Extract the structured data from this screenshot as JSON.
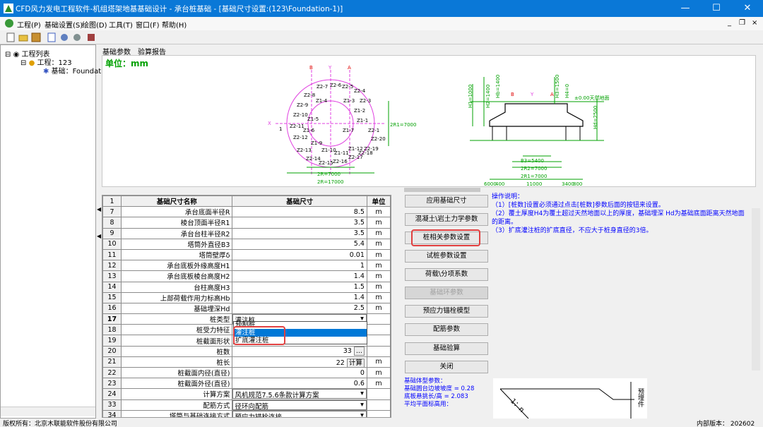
{
  "window": {
    "title": "CFD风力发电工程软件-机组塔架地基基础设计  -  承台桩基础  -  [基础尺寸设置:(123\\Foundation-1)]",
    "min": "—",
    "max": "☐",
    "close": "✕"
  },
  "menu": [
    "工程(P)",
    "基础设置(S)",
    "绘图(D)",
    "工具(T)",
    "窗口(F)",
    "帮助(H)"
  ],
  "mdi": {
    "min": "_",
    "restore": "❐",
    "close": "×"
  },
  "tree": {
    "root": "工程列表",
    "project": "工程：123",
    "foundation": "基础：Foundat"
  },
  "tabs": [
    "基础参数",
    "验算报告"
  ],
  "drawing": {
    "unit": "单位：mm",
    "plan": {
      "labels": [
        "B",
        "Y",
        "A",
        "X",
        "1",
        "2R=7000",
        "2R=17000",
        "2R1=7000"
      ],
      "piles": [
        "Z2-7",
        "Z2-6",
        "Z2-5",
        "Z2-4",
        "Z2-8",
        "Z1-3",
        "Z2-3",
        "Z2-9",
        "Z1-4",
        "Z1-2",
        "Z2-10",
        "Z1-5",
        "Z1-1",
        "Z2-11",
        "Z1-6",
        "Z2-12",
        "Z1-9",
        "Z1-7",
        "Z2-1",
        "Z2-13",
        "Z1-10",
        "Z1-11",
        "Z1-12",
        "Z2-19",
        "Z2-14",
        "Z2-16",
        "Z2-17",
        "Z2-18",
        "Z2-15",
        "Z2-20"
      ]
    },
    "section": {
      "labels": [
        "H1=1000",
        "H2=1400",
        "Hb=1400",
        "H3=1500",
        "H4=0",
        "±0.00天然地面",
        "Hd=2500",
        "B",
        "Y",
        "A",
        "B3=5400",
        "2R2=7000",
        "2R1=7000",
        "11000",
        "6000",
        "400",
        "3400",
        "800"
      ]
    }
  },
  "table": {
    "headers": {
      "no": "1",
      "name": "基础尺寸名称",
      "value": "基础尺寸",
      "unit": "单位"
    },
    "rows": [
      {
        "no": "7",
        "name": "承台底面半径R",
        "value": "8.5",
        "unit": "m"
      },
      {
        "no": "8",
        "name": "棱台顶面半径R1",
        "value": "3.5",
        "unit": "m"
      },
      {
        "no": "9",
        "name": "承台台柱半径R2",
        "value": "3.5",
        "unit": "m"
      },
      {
        "no": "10",
        "name": "塔筒外直径B3",
        "value": "5.4",
        "unit": "m"
      },
      {
        "no": "11",
        "name": "塔筒壁厚δ",
        "value": "0.01",
        "unit": "m"
      },
      {
        "no": "12",
        "name": "承台底板外缘高度H1",
        "value": "1",
        "unit": "m"
      },
      {
        "no": "13",
        "name": "承台底板棱台高度H2",
        "value": "1.4",
        "unit": "m"
      },
      {
        "no": "14",
        "name": "台柱高度H3",
        "value": "1.5",
        "unit": "m"
      },
      {
        "no": "15",
        "name": "上部荷载作用力标高Hb",
        "value": "1.4",
        "unit": "m"
      },
      {
        "no": "16",
        "name": "基础埋深Hd",
        "value": "2.5",
        "unit": "m"
      },
      {
        "no": "17",
        "name": "桩类型",
        "value": "灌注桩",
        "unit": ""
      },
      {
        "no": "18",
        "name": "桩受力特征",
        "value": "",
        "unit": ""
      },
      {
        "no": "19",
        "name": "桩截面形状",
        "value": "",
        "unit": ""
      },
      {
        "no": "20",
        "name": "桩数",
        "value": "33",
        "unit": ""
      },
      {
        "no": "21",
        "name": "桩长",
        "value": "22",
        "unit": "m"
      },
      {
        "no": "22",
        "name": "桩截面内径(直径)",
        "value": "0",
        "unit": "m"
      },
      {
        "no": "23",
        "name": "桩截面外径(直径)",
        "value": "0.6",
        "unit": "m"
      },
      {
        "no": "24",
        "name": "计算方案",
        "value": "风机规范7.5.6条款计算方案",
        "unit": ""
      },
      {
        "no": "33",
        "name": "配筋方式",
        "value": "径环向配筋",
        "unit": ""
      },
      {
        "no": "34",
        "name": "塔筒与基础连接方式",
        "value": "预应力锚栓连接",
        "unit": ""
      }
    ],
    "dropdown": [
      "预制桩",
      "灌注桩",
      "扩底灌注桩"
    ],
    "ellipsis": "...",
    "calc": "计算"
  },
  "buttons": [
    "应用基础尺寸",
    "混凝土\\岩土力学参数",
    "桩相关参数设置",
    "试桩参数设置",
    "荷载\\分项系数",
    "基础环参数",
    "预应力锚栓模型",
    "配筋参数",
    "基础验算",
    "关闭"
  ],
  "notes": [
    "操作说明：",
    "（1）[桩数]设置必须通过点击[桩数]参数后面的按钮来设置。",
    "（2）覆土厚度H4为覆土超过天然地面以上的厚度，基础埋深 Hd为基础底面距离天然地面的距离。",
    "（3）扩底灌注桩的扩底直径，不应大于桩身直径的3倍。"
  ],
  "params": [
    "基础体型参数：",
    "基础圆台边坡坡度 = 0.28",
    "底板悬挑长/高 = 2.083",
    "",
    "平均平面标高用："
  ],
  "preview": {
    "text1": "1：n",
    "text2": "预埋件"
  },
  "status": {
    "left": "版权所有：北京木联能软件股份有限公司",
    "right": "内部版本：  202602"
  },
  "colors": {
    "titlebar": "#0a78d7",
    "highlight": "#e04040",
    "notes": "#0000ff",
    "drawing_green": "#00a000",
    "drawing_magenta": "#e040e0"
  }
}
